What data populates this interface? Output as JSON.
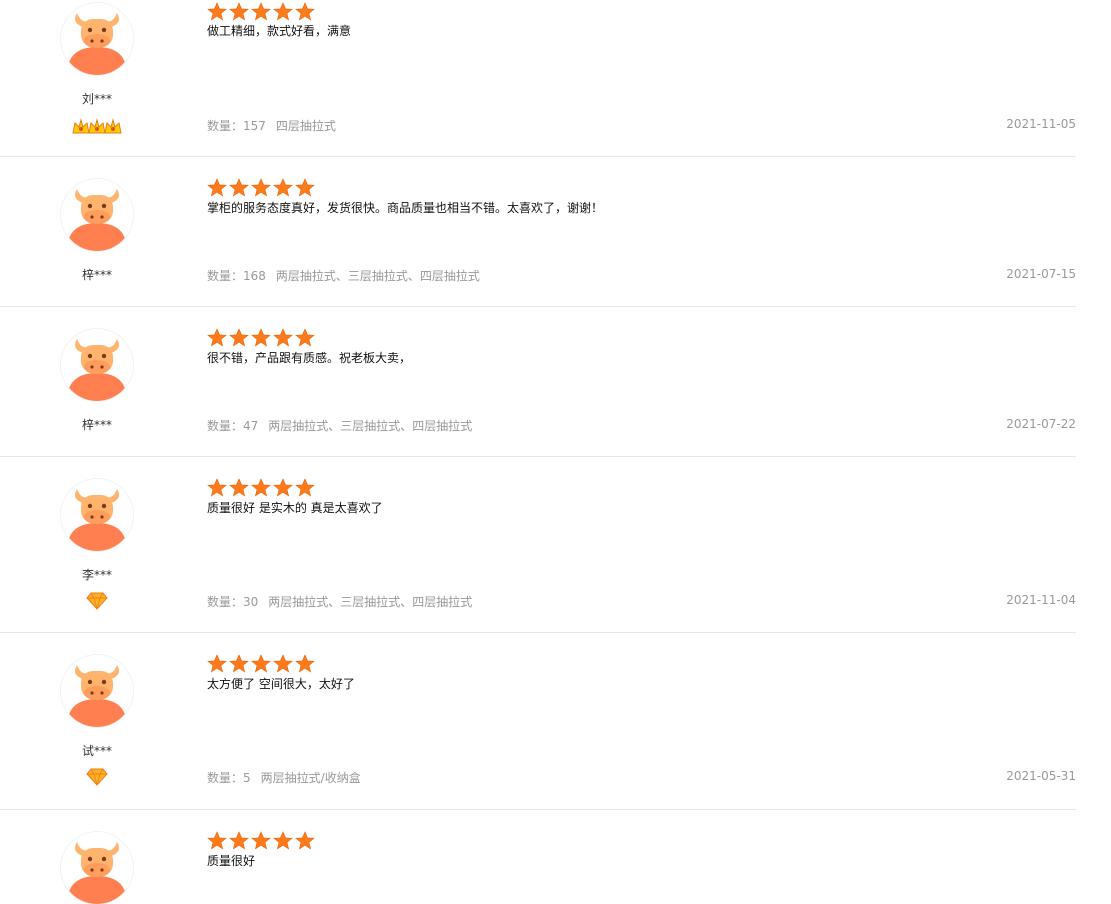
{
  "colors": {
    "star": "#ff7a1a",
    "divider": "#e6e6e6",
    "meta_text": "#999999",
    "avatar_face": "#ff7f50",
    "avatar_head": "#ffb46e"
  },
  "reviews": [
    {
      "user": "刘***",
      "rating": 5,
      "comment": "做工精细，款式好看，满意",
      "qty_label": "数量：",
      "qty": "157",
      "spec": "四层抽拉式",
      "date": "2021-11-05",
      "badge": "three-crown-icon"
    },
    {
      "user": "梓***",
      "rating": 5,
      "comment": "掌柜的服务态度真好，发货很快。商品质量也相当不错。太喜欢了，谢谢！",
      "qty_label": "数量：",
      "qty": "168",
      "spec": "两层抽拉式、三层抽拉式、四层抽拉式",
      "date": "2021-07-15",
      "badge": ""
    },
    {
      "user": "梓***",
      "rating": 5,
      "comment": "很不错，产品跟有质感。祝老板大卖，",
      "qty_label": "数量：",
      "qty": "47",
      "spec": "两层抽拉式、三层抽拉式、四层抽拉式",
      "date": "2021-07-22",
      "badge": ""
    },
    {
      "user": "李***",
      "rating": 5,
      "comment": "质量很好 是实木的 真是太喜欢了",
      "qty_label": "数量：",
      "qty": "30",
      "spec": "两层抽拉式、三层抽拉式、四层抽拉式",
      "date": "2021-11-04",
      "badge": "diamond-icon"
    },
    {
      "user": "试***",
      "rating": 5,
      "comment": "太方便了 空间很大，太好了",
      "qty_label": "数量：",
      "qty": "5",
      "spec": "两层抽拉式/收纳盒",
      "date": "2021-05-31",
      "badge": "diamond-icon"
    },
    {
      "user": "",
      "rating": 5,
      "comment": "质量很好",
      "qty_label": "",
      "qty": "",
      "spec": "",
      "date": "",
      "badge": ""
    }
  ]
}
